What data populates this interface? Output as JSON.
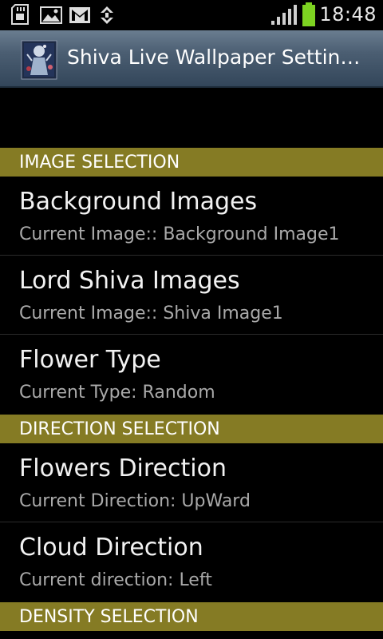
{
  "status_bar": {
    "time": "18:48",
    "icons": [
      "sd-card-icon",
      "image-icon",
      "gmail-icon",
      "usb-icon",
      "signal-icon",
      "battery-icon"
    ]
  },
  "title_bar": {
    "title": "Shiva Live Wallpaper Settin…",
    "icon": "app-icon"
  },
  "sections": [
    {
      "header": "IMAGE SELECTION",
      "items": [
        {
          "title": "Background Images",
          "summary": "Current Image:: Background Image1"
        },
        {
          "title": "Lord Shiva Images",
          "summary": "Current Image:: Shiva Image1"
        },
        {
          "title": "Flower Type",
          "summary": "Current Type: Random"
        }
      ]
    },
    {
      "header": "DIRECTION SELECTION",
      "items": [
        {
          "title": "Flowers Direction",
          "summary": "Current Direction: UpWard"
        },
        {
          "title": "Cloud Direction",
          "summary": "Current direction: Left"
        }
      ]
    },
    {
      "header": "DENSITY SELECTION",
      "items": []
    }
  ],
  "colors": {
    "category_bg": "#857b24",
    "title_bar_bg": "#4b5e72",
    "battery": "#7dd321"
  }
}
